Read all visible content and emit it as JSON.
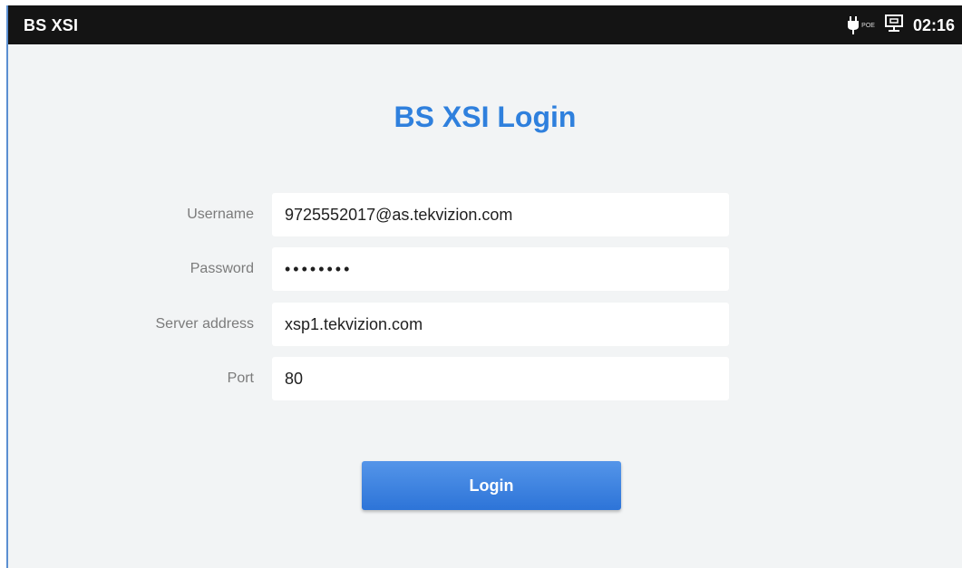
{
  "statusbar": {
    "app_title": "BS XSI",
    "poe_label": "POE",
    "time": "02:16",
    "icons": [
      "power-plug-icon",
      "network-monitor-icon"
    ]
  },
  "login": {
    "title": "BS XSI Login",
    "fields": [
      {
        "label": "Username",
        "value": "9725552017@as.tekvizion.com"
      },
      {
        "label": "Password",
        "value": "••••••••"
      },
      {
        "label": "Server address",
        "value": "xsp1.tekvizion.com"
      },
      {
        "label": "Port",
        "value": "80"
      }
    ],
    "button_label": "Login"
  },
  "colors": {
    "accent": "#2f80dd",
    "statusbar_bg": "#141414",
    "background": "#f2f4f5"
  }
}
